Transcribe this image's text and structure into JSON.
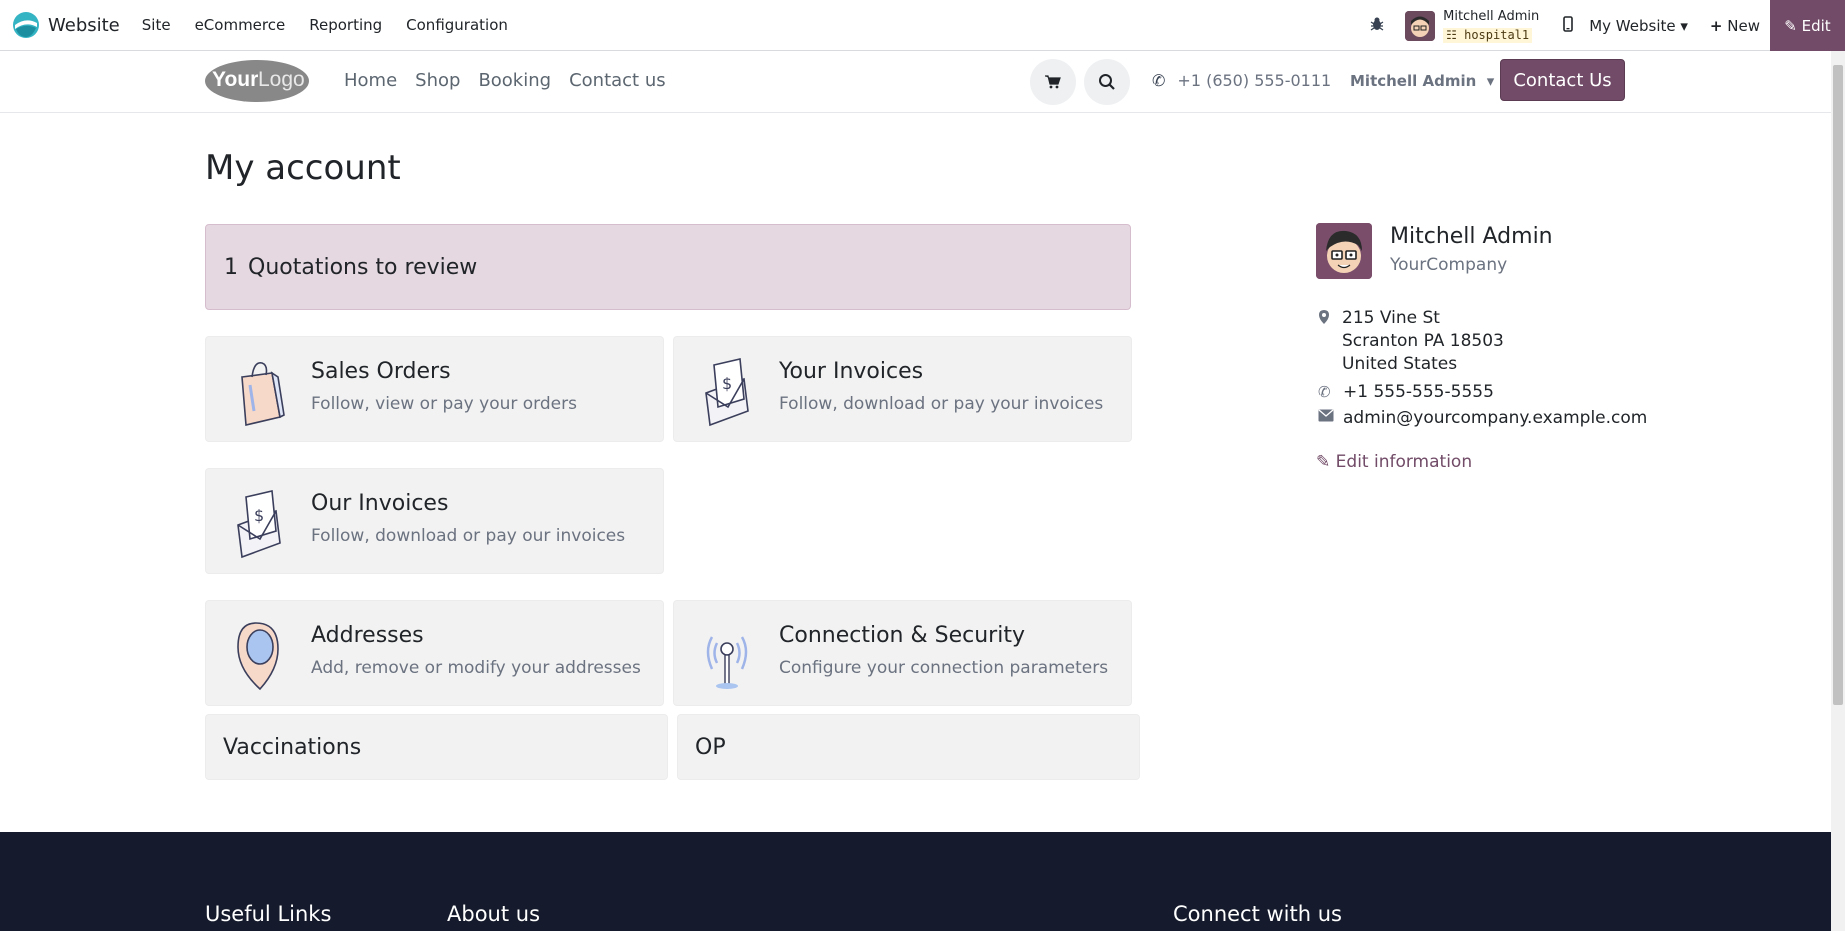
{
  "adminbar": {
    "brand": "Website",
    "menu": [
      "Site",
      "eCommerce",
      "Reporting",
      "Configuration"
    ],
    "user_name": "Mitchell Admin",
    "database": "hospital1",
    "my_website": "My Website",
    "new_label": "New",
    "edit_label": "Edit"
  },
  "sitenav": {
    "menu": [
      "Home",
      "Shop",
      "Booking",
      "Contact us"
    ],
    "phone": "+1 (650) 555-0111",
    "user": "Mitchell Admin",
    "contact_button": "Contact Us"
  },
  "main": {
    "title": "My account",
    "quotations": {
      "count": "1",
      "label": "Quotations to review"
    },
    "cards": [
      {
        "title": "Sales Orders",
        "subtitle": "Follow, view or pay your orders"
      },
      {
        "title": "Your Invoices",
        "subtitle": "Follow, download or pay your invoices"
      },
      {
        "title": "Our Invoices",
        "subtitle": "Follow, download or pay our invoices"
      },
      {
        "title": "Addresses",
        "subtitle": "Add, remove or modify your addresses"
      },
      {
        "title": "Connection & Security",
        "subtitle": "Configure your connection parameters"
      }
    ],
    "small_cards": [
      "Vaccinations",
      "OP"
    ]
  },
  "sidebar": {
    "name": "Mitchell Admin",
    "company": "YourCompany",
    "address_lines": [
      "215 Vine St",
      "Scranton PA 18503",
      "United States"
    ],
    "phone": "+1 555-555-5555",
    "email": "admin@yourcompany.example.com",
    "edit_label": "Edit information"
  },
  "footer": {
    "headings": [
      "Useful Links",
      "About us",
      "Connect with us"
    ]
  },
  "colors": {
    "primary": "#714b67",
    "quote_bg": "#e5d8e1",
    "card_bg": "#f2f2f2",
    "footer_bg": "#151b2c"
  }
}
